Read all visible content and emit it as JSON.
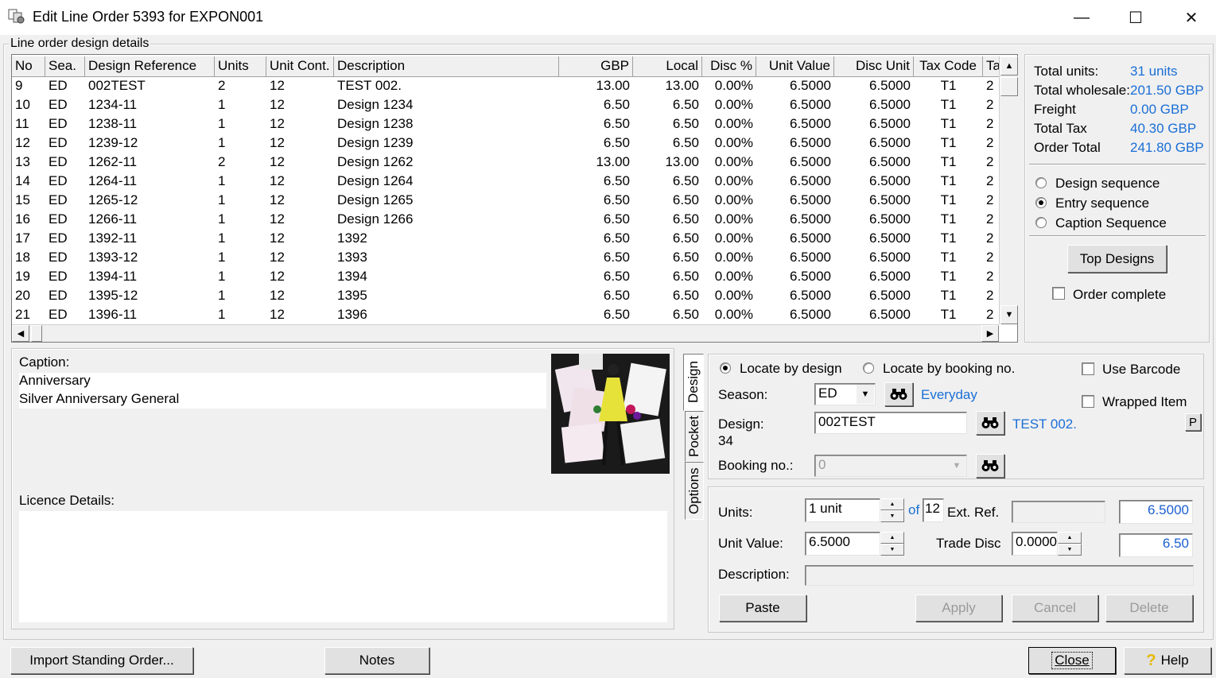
{
  "window": {
    "title": "Edit Line Order 5393 for EXPON001",
    "minimize": "—",
    "maximize": "☐",
    "close": "✕"
  },
  "group_title": "Line order design details",
  "grid": {
    "columns": [
      "No",
      "Sea.",
      "Design Reference",
      "Units",
      "Unit Cont.",
      "Description",
      "GBP",
      "Local",
      "Disc %",
      "Unit Value",
      "Disc Unit",
      "Tax Code",
      "Ta"
    ],
    "rows": [
      [
        "9",
        "ED",
        "002TEST",
        "2",
        "12",
        "TEST 002.",
        "13.00",
        "13.00",
        "0.00%",
        "6.5000",
        "6.5000",
        "T1",
        "2"
      ],
      [
        "10",
        "ED",
        "1234-11",
        "1",
        "12",
        "Design 1234",
        "6.50",
        "6.50",
        "0.00%",
        "6.5000",
        "6.5000",
        "T1",
        "2"
      ],
      [
        "11",
        "ED",
        "1238-11",
        "1",
        "12",
        "Design 1238",
        "6.50",
        "6.50",
        "0.00%",
        "6.5000",
        "6.5000",
        "T1",
        "2"
      ],
      [
        "12",
        "ED",
        "1239-12",
        "1",
        "12",
        "Design 1239",
        "6.50",
        "6.50",
        "0.00%",
        "6.5000",
        "6.5000",
        "T1",
        "2"
      ],
      [
        "13",
        "ED",
        "1262-11",
        "2",
        "12",
        "Design 1262",
        "13.00",
        "13.00",
        "0.00%",
        "6.5000",
        "6.5000",
        "T1",
        "2"
      ],
      [
        "14",
        "ED",
        "1264-11",
        "1",
        "12",
        "Design 1264",
        "6.50",
        "6.50",
        "0.00%",
        "6.5000",
        "6.5000",
        "T1",
        "2"
      ],
      [
        "15",
        "ED",
        "1265-12",
        "1",
        "12",
        "Design 1265",
        "6.50",
        "6.50",
        "0.00%",
        "6.5000",
        "6.5000",
        "T1",
        "2"
      ],
      [
        "16",
        "ED",
        "1266-11",
        "1",
        "12",
        "Design 1266",
        "6.50",
        "6.50",
        "0.00%",
        "6.5000",
        "6.5000",
        "T1",
        "2"
      ],
      [
        "17",
        "ED",
        "1392-11",
        "1",
        "12",
        "1392",
        "6.50",
        "6.50",
        "0.00%",
        "6.5000",
        "6.5000",
        "T1",
        "2"
      ],
      [
        "18",
        "ED",
        "1393-12",
        "1",
        "12",
        "1393",
        "6.50",
        "6.50",
        "0.00%",
        "6.5000",
        "6.5000",
        "T1",
        "2"
      ],
      [
        "19",
        "ED",
        "1394-11",
        "1",
        "12",
        "1394",
        "6.50",
        "6.50",
        "0.00%",
        "6.5000",
        "6.5000",
        "T1",
        "2"
      ],
      [
        "20",
        "ED",
        "1395-12",
        "1",
        "12",
        "1395",
        "6.50",
        "6.50",
        "0.00%",
        "6.5000",
        "6.5000",
        "T1",
        "2"
      ],
      [
        "21",
        "ED",
        "1396-11",
        "1",
        "12",
        "1396",
        "6.50",
        "6.50",
        "0.00%",
        "6.5000",
        "6.5000",
        "T1",
        "2"
      ]
    ]
  },
  "totals": {
    "units_label": "Total units:",
    "units_value": "31 units",
    "wholesale_label": "Total wholesale:",
    "wholesale_value": "201.50 GBP",
    "freight_label": "Freight",
    "freight_value": "0.00 GBP",
    "tax_label": "Total Tax",
    "tax_value": "40.30 GBP",
    "order_label": "Order Total",
    "order_value": "241.80 GBP"
  },
  "sequence": {
    "design": "Design sequence",
    "entry": "Entry sequence",
    "caption": "Caption Sequence",
    "selected": "entry"
  },
  "top_designs_label": "Top Designs",
  "order_complete_label": "Order complete",
  "caption": {
    "label": "Caption:",
    "line1": "Anniversary",
    "line2": "Silver Anniversary General"
  },
  "licence_label": "Licence Details:",
  "tabs": [
    "Design",
    "Pocket",
    "Options"
  ],
  "locate": {
    "by_design": "Locate by design",
    "by_booking": "Locate by booking no.",
    "use_barcode": "Use Barcode",
    "wrapped_item": "Wrapped Item",
    "season_label": "Season:",
    "season_value": "ED",
    "season_name": "Everyday",
    "design_label": "Design:",
    "design_number": "34",
    "design_value": "002TEST",
    "design_name": "TEST 002.",
    "booking_label": "Booking no.:",
    "booking_value": "0",
    "p_button": "P"
  },
  "line": {
    "units_label": "Units:",
    "units_value": "1 unit",
    "of_label": "of",
    "of_value": "12",
    "ext_ref_label": "Ext. Ref.",
    "ext_ref_value": "",
    "ext_total": "6.5000",
    "unit_value_label": "Unit Value:",
    "unit_value": "6.5000",
    "trade_disc_label": "Trade Disc",
    "trade_disc_value": "0.0000",
    "line_total": "6.50",
    "description_label": "Description:",
    "description_value": ""
  },
  "actions": {
    "paste": "Paste",
    "apply": "Apply",
    "cancel": "Cancel",
    "delete": "Delete"
  },
  "footer": {
    "import": "Import Standing Order...",
    "notes": "Notes",
    "close": "Close",
    "help": "Help"
  }
}
